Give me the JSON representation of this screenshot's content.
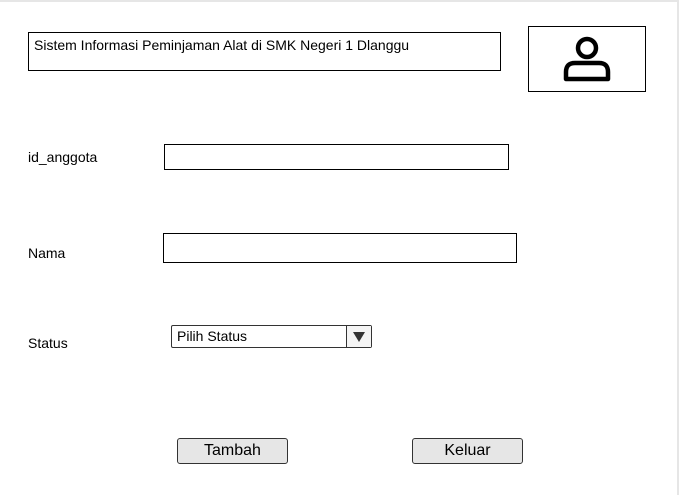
{
  "header": {
    "title": "Sistem Informasi Peminjaman Alat di SMK Negeri 1 Dlanggu",
    "avatar_icon": "user-icon"
  },
  "form": {
    "id_anggota": {
      "label": "id_anggota",
      "value": "",
      "placeholder": ""
    },
    "nama": {
      "label": "Nama",
      "value": "",
      "placeholder": ""
    },
    "status": {
      "label": "Status",
      "selected": "Pilih Status",
      "arrow_icon": "triangle-down-icon"
    }
  },
  "actions": {
    "tambah_label": "Tambah",
    "keluar_label": "Keluar"
  },
  "colors": {
    "border": "#000000",
    "button_bg": "#e6e6e6",
    "frame_border": "#e6e6e6"
  }
}
